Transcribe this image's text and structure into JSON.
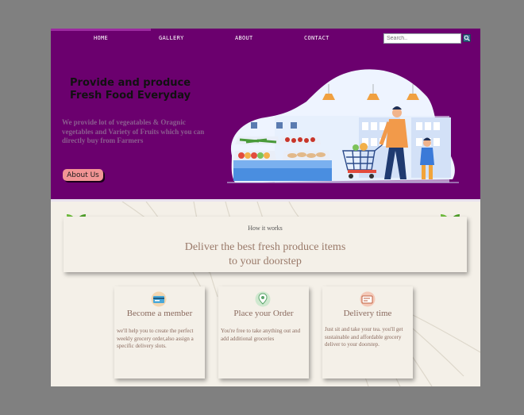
{
  "nav": {
    "items": [
      {
        "label": "HOME"
      },
      {
        "label": "GALLERY"
      },
      {
        "label": "ABOUT"
      },
      {
        "label": "CONTACT"
      }
    ],
    "search_placeholder": "Search.."
  },
  "hero": {
    "title_line1": "Provide and produce",
    "title_line2": "Fresh Food Everyday",
    "description": "We provide lot of vegeatables & Oragnic vegetables and Variety of Fruits which you can directly buy from Farmers",
    "button_label": "About Us"
  },
  "how": {
    "label": "How it works",
    "title_line1": "Deliver the best fresh produce items",
    "title_line2": "to your doorstep"
  },
  "steps": [
    {
      "title": "Become a member",
      "text": "we'll help you to create the perfect weekly grocery order,also assign a specific delivery slots.",
      "icon": "membership-card-icon"
    },
    {
      "title": "Place your Order",
      "text": "You're free to take anything out and add additional groceries",
      "icon": "location-pin-icon"
    },
    {
      "title": "Delivery time",
      "text": "Just sit and take your tea. you'll get sustainable and affordable grocery deliver to your doorstep.",
      "icon": "delivery-box-icon"
    }
  ],
  "colors": {
    "hero_bg": "#6b006e",
    "page_bg": "#808080",
    "content_bg": "#f4f0e8",
    "button_bg": "#f29595",
    "heading_brown": "#9a7a6a"
  }
}
